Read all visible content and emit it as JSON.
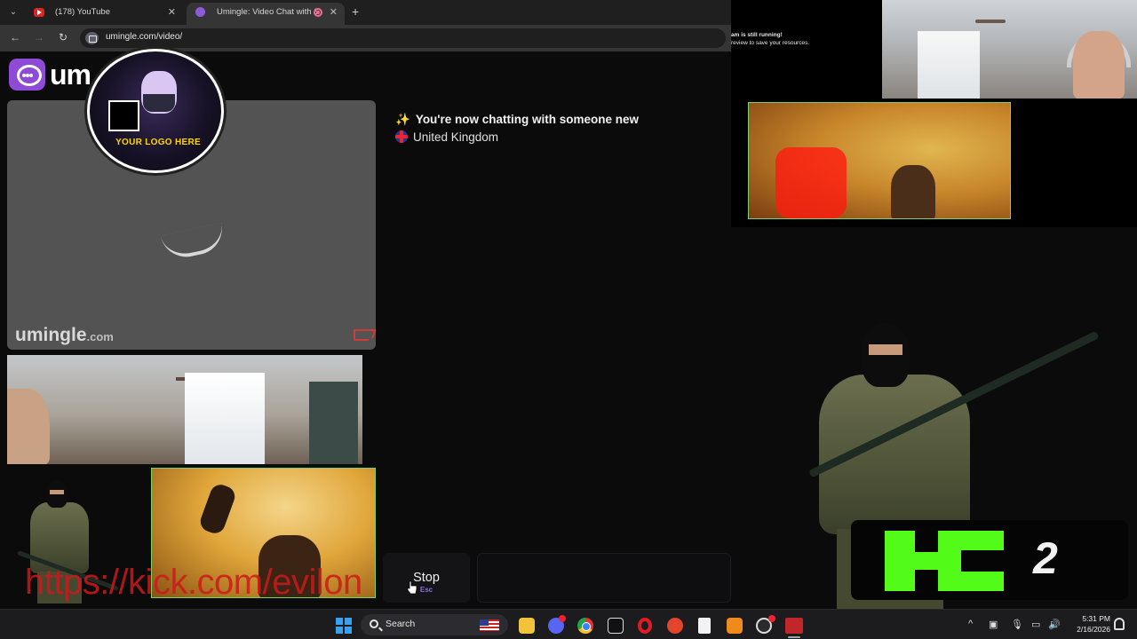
{
  "browser": {
    "tabs": [
      {
        "label": "(178) YouTube",
        "active": false
      },
      {
        "label": "Umingle: Video Chat with S",
        "active": true
      }
    ],
    "new_tab_symbol": "+",
    "tab_menu_symbol": "⌄",
    "close_symbol": "✕",
    "url": "umingle.com/video/",
    "nav": {
      "back": "←",
      "forward": "→",
      "reload": "↻"
    }
  },
  "site": {
    "logo_text": "um",
    "self_video_watermark": "umingle",
    "self_video_watermark_suffix": ".com",
    "chat": {
      "status_line": "You're now chatting with someone new",
      "status_icon": "sparkles-icon",
      "country": "United Kingdom"
    },
    "stop_button": {
      "label": "Stop",
      "hint": "Esc"
    },
    "message_input_placeholder": ""
  },
  "overlay": {
    "streamer_logo_tag": "YOUR LOGO HERE",
    "notice_line1": "am is still running!",
    "notice_line2": "review to save your resources.",
    "kick_url": "https://kick.com/evilon",
    "k2_label": "2",
    "kick_color": "#53fc18",
    "brand_purple": "#8e4bd6"
  },
  "taskbar": {
    "search_label": "Search",
    "tray_chevron": "^",
    "clock_time": "5:31 PM",
    "clock_date": "2/16/2026",
    "apps": [
      "file-explorer-icon",
      "discord-icon",
      "chrome-icon",
      "capcut-icon",
      "opera-icon",
      "red-app-icon",
      "file-icon",
      "orange-app-icon",
      "obs-icon",
      "voicemod-icon"
    ]
  }
}
